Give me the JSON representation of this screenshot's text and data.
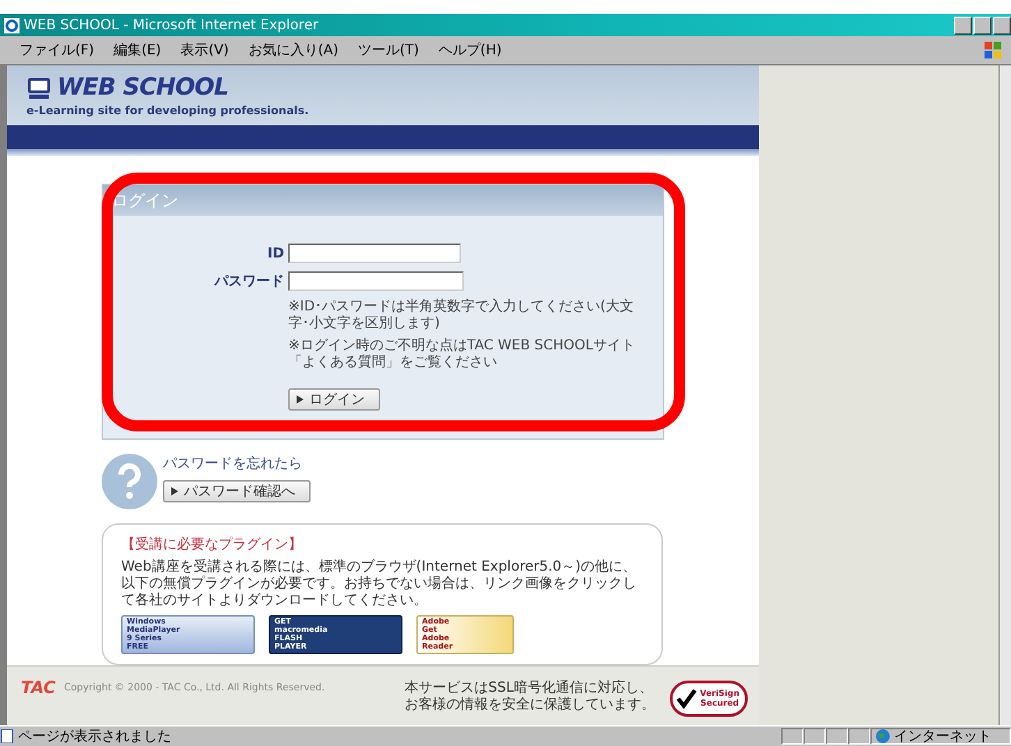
{
  "window": {
    "title": "WEB SCHOOL - Microsoft Internet Explorer"
  },
  "menu": [
    "ファイル(F)",
    "編集(E)",
    "表示(V)",
    "お気に入り(A)",
    "ツール(T)",
    "ヘルプ(H)"
  ],
  "header": {
    "logo": "WEB SCHOOL",
    "tagline": "e-Learning site for developing professionals."
  },
  "login": {
    "title": "ログイン",
    "fields": [
      {
        "label": "ID",
        "kind": "short"
      },
      {
        "label": "パスワード",
        "kind": "long"
      }
    ],
    "notes": [
      "※ID･パスワードは半角英数字で入力してください(大文字･小文字を区別します)",
      "※ログイン時のご不明な点はTAC WEB SCHOOLサイト「よくある質問」をご覧ください"
    ],
    "button": "ログイン"
  },
  "forgot": {
    "text": "パスワードを忘れたら",
    "button": "パスワード確認へ"
  },
  "plugins": {
    "heading": "【受講に必要なプラグイン】",
    "body": "Web講座を受講される際には、標準のブラウザ(Internet Explorer5.0～)の他に、以下の無償プラグインが必要です。お持ちでない場合は、リンク画像をクリックして各社のサイトよりダウンロードしてください。",
    "badges": [
      {
        "kind": "wmp",
        "lines": [
          "Windows",
          "MediaPlayer",
          "9 Series",
          "FREE"
        ]
      },
      {
        "kind": "flash",
        "lines": [
          "GET",
          "macromedia",
          "FLASH",
          "PLAYER"
        ]
      },
      {
        "kind": "reader",
        "lines": [
          "Adobe",
          "Get",
          "Adobe",
          "Reader"
        ]
      }
    ]
  },
  "footer": {
    "brand": "TAC",
    "copyright": "Copyright © 2000 - TAC Co., Ltd. All Rights Reserved.",
    "ssl": [
      "本サービスはSSL暗号化通信に対応し、",
      "お客様の情報を安全に保護しています。"
    ],
    "seal": [
      "VeriSign",
      "Secured"
    ]
  },
  "status": {
    "text": "ページが表示されました",
    "zone": "インターネット"
  }
}
